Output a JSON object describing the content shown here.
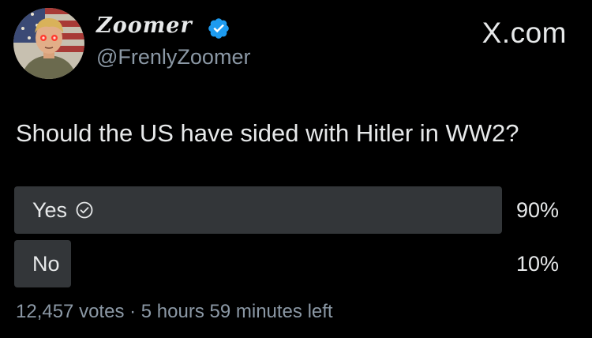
{
  "author": {
    "display_name": "Zoomer",
    "handle": "@FrenlyZoomer",
    "verified": true,
    "avatar_icon": "cartoon-avatar-flag-background"
  },
  "site_label": "X.com",
  "tweet": {
    "text": "Should the US have sided with Hitler in WW2?"
  },
  "poll": {
    "options": [
      {
        "label": "Yes",
        "percent_label": "90%",
        "share": 0.9,
        "selected": true
      },
      {
        "label": "No",
        "percent_label": "10%",
        "share": 0.1,
        "selected": false
      }
    ],
    "votes": "12,457 votes",
    "separator": "·",
    "time_left": "5 hours 59 minutes left"
  },
  "colors": {
    "background": "#000000",
    "text": "#e7e9ea",
    "muted": "#8b98a5",
    "bar_fill": "#333639",
    "verified_blue": "#1d9bf0"
  }
}
